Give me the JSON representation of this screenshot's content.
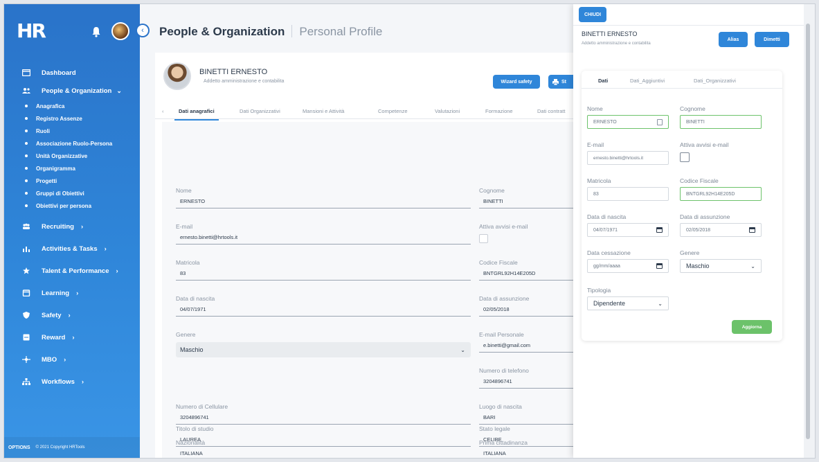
{
  "sidebar": {
    "logo": "HR",
    "nav": [
      {
        "label": "Dashboard"
      },
      {
        "label": "People & Organization",
        "chevron": "⌄"
      },
      {
        "label": "Recruiting",
        "chevron": "›"
      },
      {
        "label": "Activities & Tasks",
        "chevron": "›"
      },
      {
        "label": "Talent & Performance",
        "chevron": "›"
      },
      {
        "label": "Learning",
        "chevron": "›"
      },
      {
        "label": "Safety",
        "chevron": "›"
      },
      {
        "label": "Reward",
        "chevron": "›"
      },
      {
        "label": "MBO",
        "chevron": "›"
      },
      {
        "label": "Workflows",
        "chevron": "›"
      }
    ],
    "sub_items": [
      "Anagrafica",
      "Registro Assenze",
      "Ruoli",
      "Associazione Ruolo-Persona",
      "Unità Organizzative",
      "Organigramma",
      "Progetti",
      "Gruppi di Obiettivi",
      "Obiettivi per persona"
    ],
    "options_label": "OPTIONS",
    "copyright": "© 2021 Copyright HRTools"
  },
  "header": {
    "title": "People & Organization",
    "subtitle": "Personal Profile"
  },
  "profile": {
    "name": "BINETTI ERNESTO",
    "role": "Addetto amministrazione e contabilita",
    "wizard_btn": "Wizard safety",
    "print_btn": "St"
  },
  "tabs": [
    "Dati anagrafici",
    "Dati Organizzativi",
    "Mansioni e Attività",
    "Competenze",
    "Valutazioni",
    "Formazione",
    "Dati contratt"
  ],
  "form": {
    "nome": {
      "label": "Nome",
      "value": "ERNESTO"
    },
    "cognome": {
      "label": "Cognome",
      "value": "BINETTI"
    },
    "email": {
      "label": "E-mail",
      "value": "ernesto.binetti@hrtools.it"
    },
    "avvisi": {
      "label": "Attiva avvisi e-mail"
    },
    "matricola": {
      "label": "Matricola",
      "value": "83"
    },
    "cf": {
      "label": "Codice Fiscale",
      "value": "BNTGRL92H14E205D"
    },
    "nascita": {
      "label": "Data di nascita",
      "value": "04/07/1971"
    },
    "assunzione": {
      "label": "Data di assunzione",
      "value": "02/05/2018"
    },
    "genere": {
      "label": "Genere",
      "value": "Maschio"
    },
    "email_pers": {
      "label": "E-mail Personale",
      "value": "e.binetti@gmail.com"
    },
    "telefono": {
      "label": "Numero di telefono",
      "value": "3204896741"
    },
    "cellulare": {
      "label": "Numero di Cellulare",
      "value": "3204896741"
    },
    "luogo": {
      "label": "Luogo di nascita",
      "value": "BARI"
    },
    "nazionalita": {
      "label": "Nazionalità",
      "value": "ITALIANA"
    },
    "cittadinanza": {
      "label": "Prima cittadinanza",
      "value": "ITALIANA"
    },
    "titolo": {
      "label": "Titolo di studio",
      "value": "LAUREA"
    },
    "stato": {
      "label": "Stato legale",
      "value": "CELIBE"
    }
  },
  "panel": {
    "close_btn": "CHIUDI",
    "name": "BINETTI ERNESTO",
    "role": "Addetto amministrazione e contabilita",
    "alias_btn": "Alias",
    "dimetti_btn": "Dimetti",
    "tabs": [
      "Dati",
      "Dati_Aggiuntivi",
      "Dati_Organizzativi"
    ],
    "fields": {
      "nome": {
        "label": "Nome",
        "value": "ERNESTO"
      },
      "cognome": {
        "label": "Cognome",
        "value": "BINETTI"
      },
      "email": {
        "label": "E-mail",
        "value": "ernesto.binetti@hrtools.it"
      },
      "avvisi": {
        "label": "Attiva avvisi e-mail"
      },
      "matricola": {
        "label": "Matricola",
        "value": "83"
      },
      "cf": {
        "label": "Codice Fiscale",
        "value": "BNTGRL92H14E205D"
      },
      "nascita": {
        "label": "Data di nascita",
        "value": "04/07/1971"
      },
      "assunzione": {
        "label": "Data di assunzione",
        "value": "02/05/2018"
      },
      "cessazione": {
        "label": "Data cessazione",
        "placeholder": "gg/mm/aaaa"
      },
      "genere": {
        "label": "Genere",
        "value": "Maschio"
      },
      "tipologia": {
        "label": "Tipologia",
        "value": "Dipendente"
      }
    },
    "update_btn": "Aggiorna"
  },
  "colors": {
    "primary": "#2f86d9",
    "success": "#6cc26a",
    "sidebar": "#2a73c9"
  }
}
